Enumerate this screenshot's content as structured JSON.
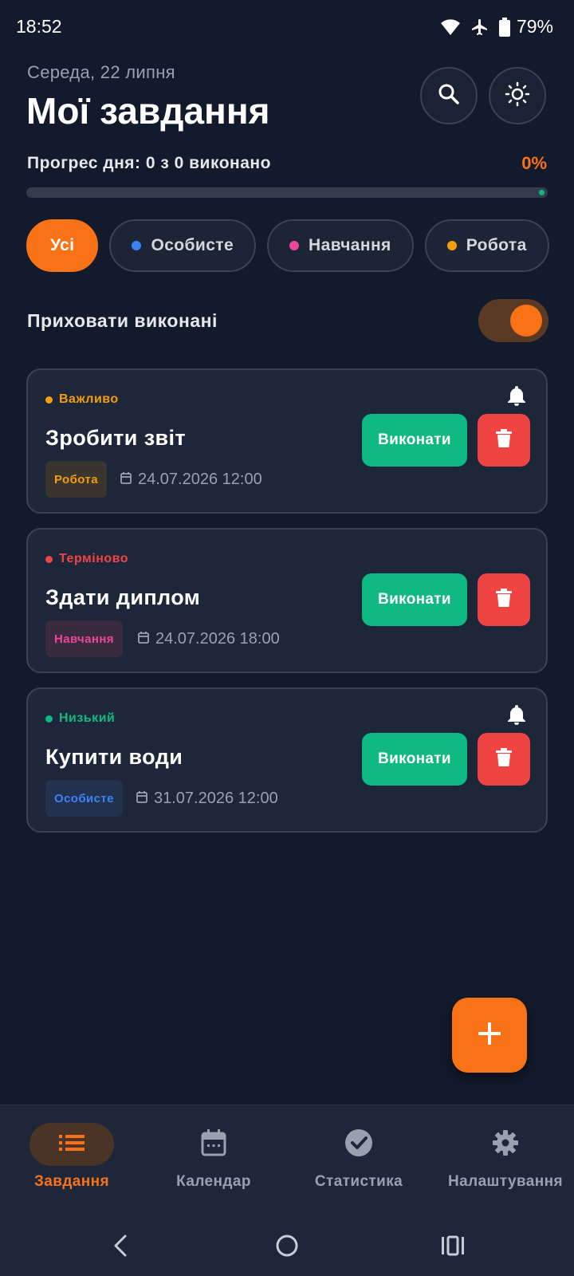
{
  "status_bar": {
    "time": "18:52",
    "battery": "79%"
  },
  "header": {
    "date": "Середа, 22 липня",
    "title": "Мої завдання",
    "progress_label": "Прогрес дня: 0 з 0 виконано",
    "progress_percent": "0%",
    "progress_value": 0
  },
  "filters": [
    {
      "label": "Усі",
      "active": true
    },
    {
      "label": "Особисте",
      "dot_color": "#3b82f6"
    },
    {
      "label": "Навчання",
      "dot_color": "#ec4899"
    },
    {
      "label": "Робота",
      "dot_color": "#f59e0b"
    }
  ],
  "hide_completed": {
    "label": "Приховати виконані",
    "enabled": true
  },
  "tasks": [
    {
      "priority": "Важливо",
      "priority_color": "#f59e0b",
      "title": "Зробити звіт",
      "category": "Робота",
      "category_color": "#f59e0b",
      "category_bg": "#3a352e",
      "due": "24.07.2026 12:00",
      "bell": true,
      "done_label": "Виконати"
    },
    {
      "priority": "Терміново",
      "priority_color": "#ef4444",
      "title": "Здати диплом",
      "category": "Навчання",
      "category_color": "#ec4899",
      "category_bg": "#3a2a3e",
      "due": "24.07.2026 18:00",
      "bell": false,
      "done_label": "Виконати"
    },
    {
      "priority": "Низький",
      "priority_color": "#10b981",
      "title": "Купити води",
      "category": "Особисте",
      "category_color": "#3b82f6",
      "category_bg": "#22324e",
      "due": "31.07.2026 12:00",
      "bell": true,
      "done_label": "Виконати"
    }
  ],
  "bottom_nav": [
    {
      "label": "Завдання",
      "icon": "list-icon",
      "active": true
    },
    {
      "label": "Календар",
      "icon": "calendar-icon"
    },
    {
      "label": "Статистика",
      "icon": "check-circle-icon"
    },
    {
      "label": "Налаштування",
      "icon": "gear-icon"
    }
  ],
  "colors": {
    "accent": "#f97316",
    "success": "#10b981",
    "danger": "#ef4444",
    "background": "#131a2b",
    "card": "#1e2739"
  }
}
